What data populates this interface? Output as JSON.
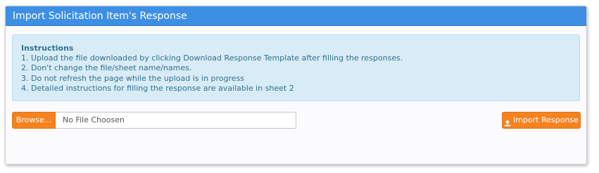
{
  "panel": {
    "title": "Import Solicitation Item's Response"
  },
  "instructions": {
    "title": "Instructions",
    "lines": [
      "1. Upload the file downloaded by clicking Download Response Template after filling the responses.",
      "2. Don't change the file/sheet name/names.",
      "3. Do not refresh the page while the upload is in progress",
      "4. Detailed instructions for filling the response are available in sheet 2"
    ]
  },
  "file_upload": {
    "browse_label": "Browse...",
    "file_name": "No File Choosen"
  },
  "actions": {
    "import_label": "Import Response",
    "import_icon": "upload-icon"
  },
  "colors": {
    "header": "#3d8fe3",
    "accent": "#f4821f",
    "info_bg": "#d8ecf7",
    "info_text": "#31708f"
  }
}
